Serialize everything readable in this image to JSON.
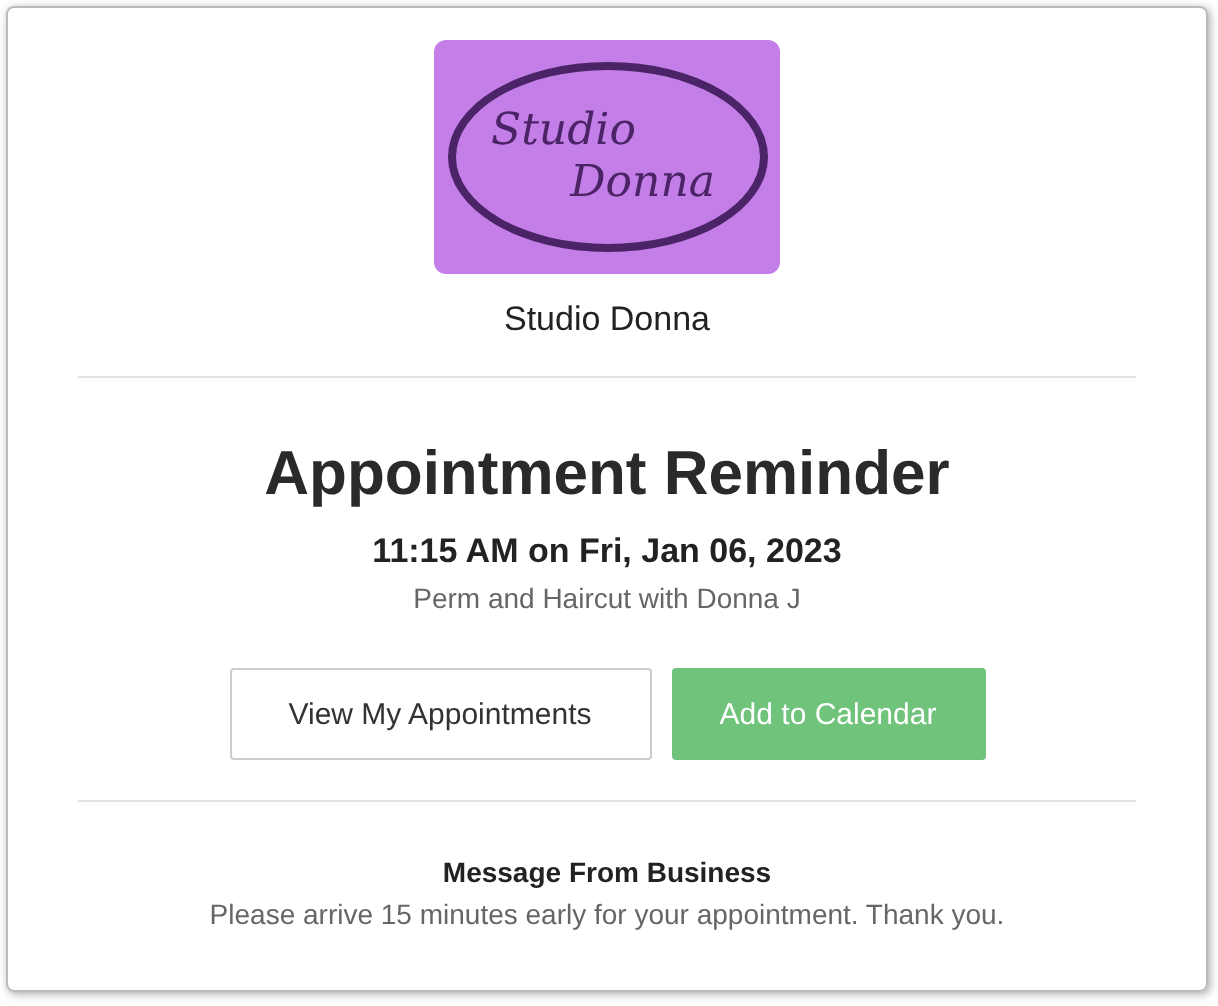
{
  "logo": {
    "lines": [
      "Studio",
      "Donna"
    ]
  },
  "business_name": "Studio Donna",
  "title": "Appointment Reminder",
  "datetime": "11:15 AM on Fri, Jan 06, 2023",
  "service": "Perm and Haircut with Donna J",
  "buttons": [
    {
      "label": "View My Appointments",
      "kind": "outline"
    },
    {
      "label": "Add to Calendar",
      "kind": "primary"
    }
  ],
  "message": {
    "heading": "Message From Business",
    "text": "Please arrive 15 minutes early for your appointment. Thank you."
  }
}
